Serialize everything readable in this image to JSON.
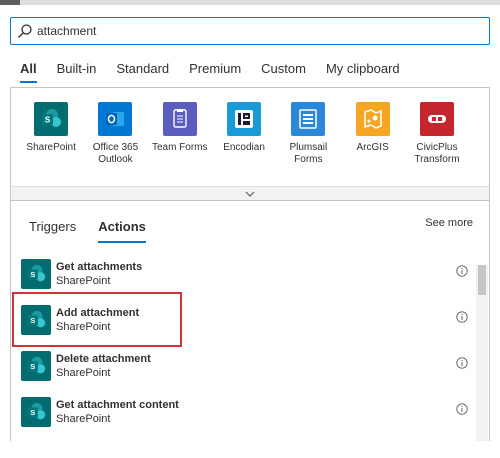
{
  "search": {
    "value": "attachment",
    "placeholder": ""
  },
  "category_tabs": [
    {
      "label": "All",
      "active": true
    },
    {
      "label": "Built-in"
    },
    {
      "label": "Standard"
    },
    {
      "label": "Premium"
    },
    {
      "label": "Custom"
    },
    {
      "label": "My clipboard"
    }
  ],
  "connectors": [
    {
      "name": "SharePoint",
      "icon": "sharepoint-icon",
      "color": "#036c70"
    },
    {
      "name": "Office 365 Outlook",
      "icon": "outlook-icon",
      "color": "#0078d4"
    },
    {
      "name": "Team Forms",
      "icon": "team-forms-icon",
      "color": "#5c5cbf"
    },
    {
      "name": "Encodian",
      "icon": "encodian-icon",
      "color": "#1a9bd7"
    },
    {
      "name": "Plumsail Forms",
      "icon": "plumsail-forms-icon",
      "color": "#2b88d8"
    },
    {
      "name": "ArcGIS",
      "icon": "arcgis-icon",
      "color": "#f5a623"
    },
    {
      "name": "CivicPlus Transform",
      "icon": "civicplus-icon",
      "color": "#c4262e"
    }
  ],
  "action_tabs": {
    "triggers": "Triggers",
    "actions": "Actions",
    "see_more": "See more"
  },
  "actions": [
    {
      "title": "Get attachments",
      "connector": "SharePoint"
    },
    {
      "title": "Add attachment",
      "connector": "SharePoint",
      "highlighted": true
    },
    {
      "title": "Delete attachment",
      "connector": "SharePoint"
    },
    {
      "title": "Get attachment content",
      "connector": "SharePoint"
    }
  ],
  "colors": {
    "accent": "#0078d4",
    "highlight": "#d13438",
    "sharepoint": "#036c70"
  }
}
